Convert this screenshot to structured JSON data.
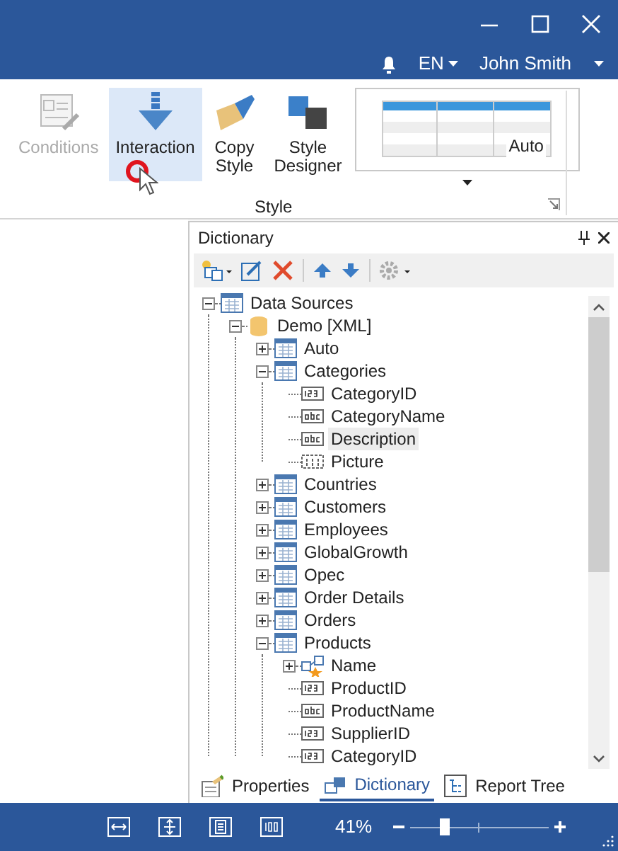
{
  "header": {
    "language": "EN",
    "user": "John Smith"
  },
  "ribbon": {
    "buttons": [
      {
        "label": "Conditions",
        "kind": "conditions",
        "disabled": true,
        "selected": false
      },
      {
        "label": "Interaction",
        "kind": "interaction",
        "disabled": false,
        "selected": true
      },
      {
        "label": "Copy\nStyle",
        "kind": "copy-style",
        "disabled": false,
        "selected": false
      },
      {
        "label": "Style\nDesigner",
        "kind": "style-designer",
        "disabled": false,
        "selected": false
      }
    ],
    "gallery": {
      "label": "Auto"
    },
    "group_label": "Style"
  },
  "dictionary": {
    "title": "Dictionary",
    "tree": [
      {
        "label": "Data Sources",
        "kind": "sources",
        "expanded": true,
        "selected": false,
        "children": [
          {
            "label": "Demo [XML]",
            "kind": "database",
            "expanded": true,
            "selected": false,
            "children": [
              {
                "label": "Auto",
                "kind": "table",
                "expanded": false,
                "selected": false
              },
              {
                "label": "Categories",
                "kind": "table",
                "expanded": true,
                "selected": false,
                "children": [
                  {
                    "label": "CategoryID",
                    "kind": "number",
                    "selected": false
                  },
                  {
                    "label": "CategoryName",
                    "kind": "text",
                    "selected": false
                  },
                  {
                    "label": "Description",
                    "kind": "text",
                    "selected": true
                  },
                  {
                    "label": "Picture",
                    "kind": "image",
                    "selected": false
                  }
                ]
              },
              {
                "label": "Countries",
                "kind": "table",
                "expanded": false,
                "selected": false
              },
              {
                "label": "Customers",
                "kind": "table",
                "expanded": false,
                "selected": false
              },
              {
                "label": "Employees",
                "kind": "table",
                "expanded": false,
                "selected": false
              },
              {
                "label": "GlobalGrowth",
                "kind": "table",
                "expanded": false,
                "selected": false
              },
              {
                "label": "Opec",
                "kind": "table",
                "expanded": false,
                "selected": false
              },
              {
                "label": "Order Details",
                "kind": "table",
                "expanded": false,
                "selected": false
              },
              {
                "label": "Orders",
                "kind": "table",
                "expanded": false,
                "selected": false
              },
              {
                "label": "Products",
                "kind": "table",
                "expanded": true,
                "selected": false,
                "children": [
                  {
                    "label": "Name",
                    "kind": "relation",
                    "expanded": false,
                    "selected": false
                  },
                  {
                    "label": "ProductID",
                    "kind": "number",
                    "selected": false
                  },
                  {
                    "label": "ProductName",
                    "kind": "text",
                    "selected": false
                  },
                  {
                    "label": "SupplierID",
                    "kind": "number",
                    "selected": false
                  },
                  {
                    "label": "CategoryID",
                    "kind": "number",
                    "selected": false
                  }
                ]
              }
            ]
          }
        ]
      }
    ],
    "tabs": [
      {
        "label": "Properties",
        "kind": "properties",
        "selected": false
      },
      {
        "label": "Dictionary",
        "kind": "dictionary",
        "selected": true
      },
      {
        "label": "Report Tree",
        "kind": "report-tree",
        "selected": false
      }
    ]
  },
  "status_bar": {
    "zoom": "41%",
    "zoom_slider": {
      "level": 0.24
    }
  }
}
